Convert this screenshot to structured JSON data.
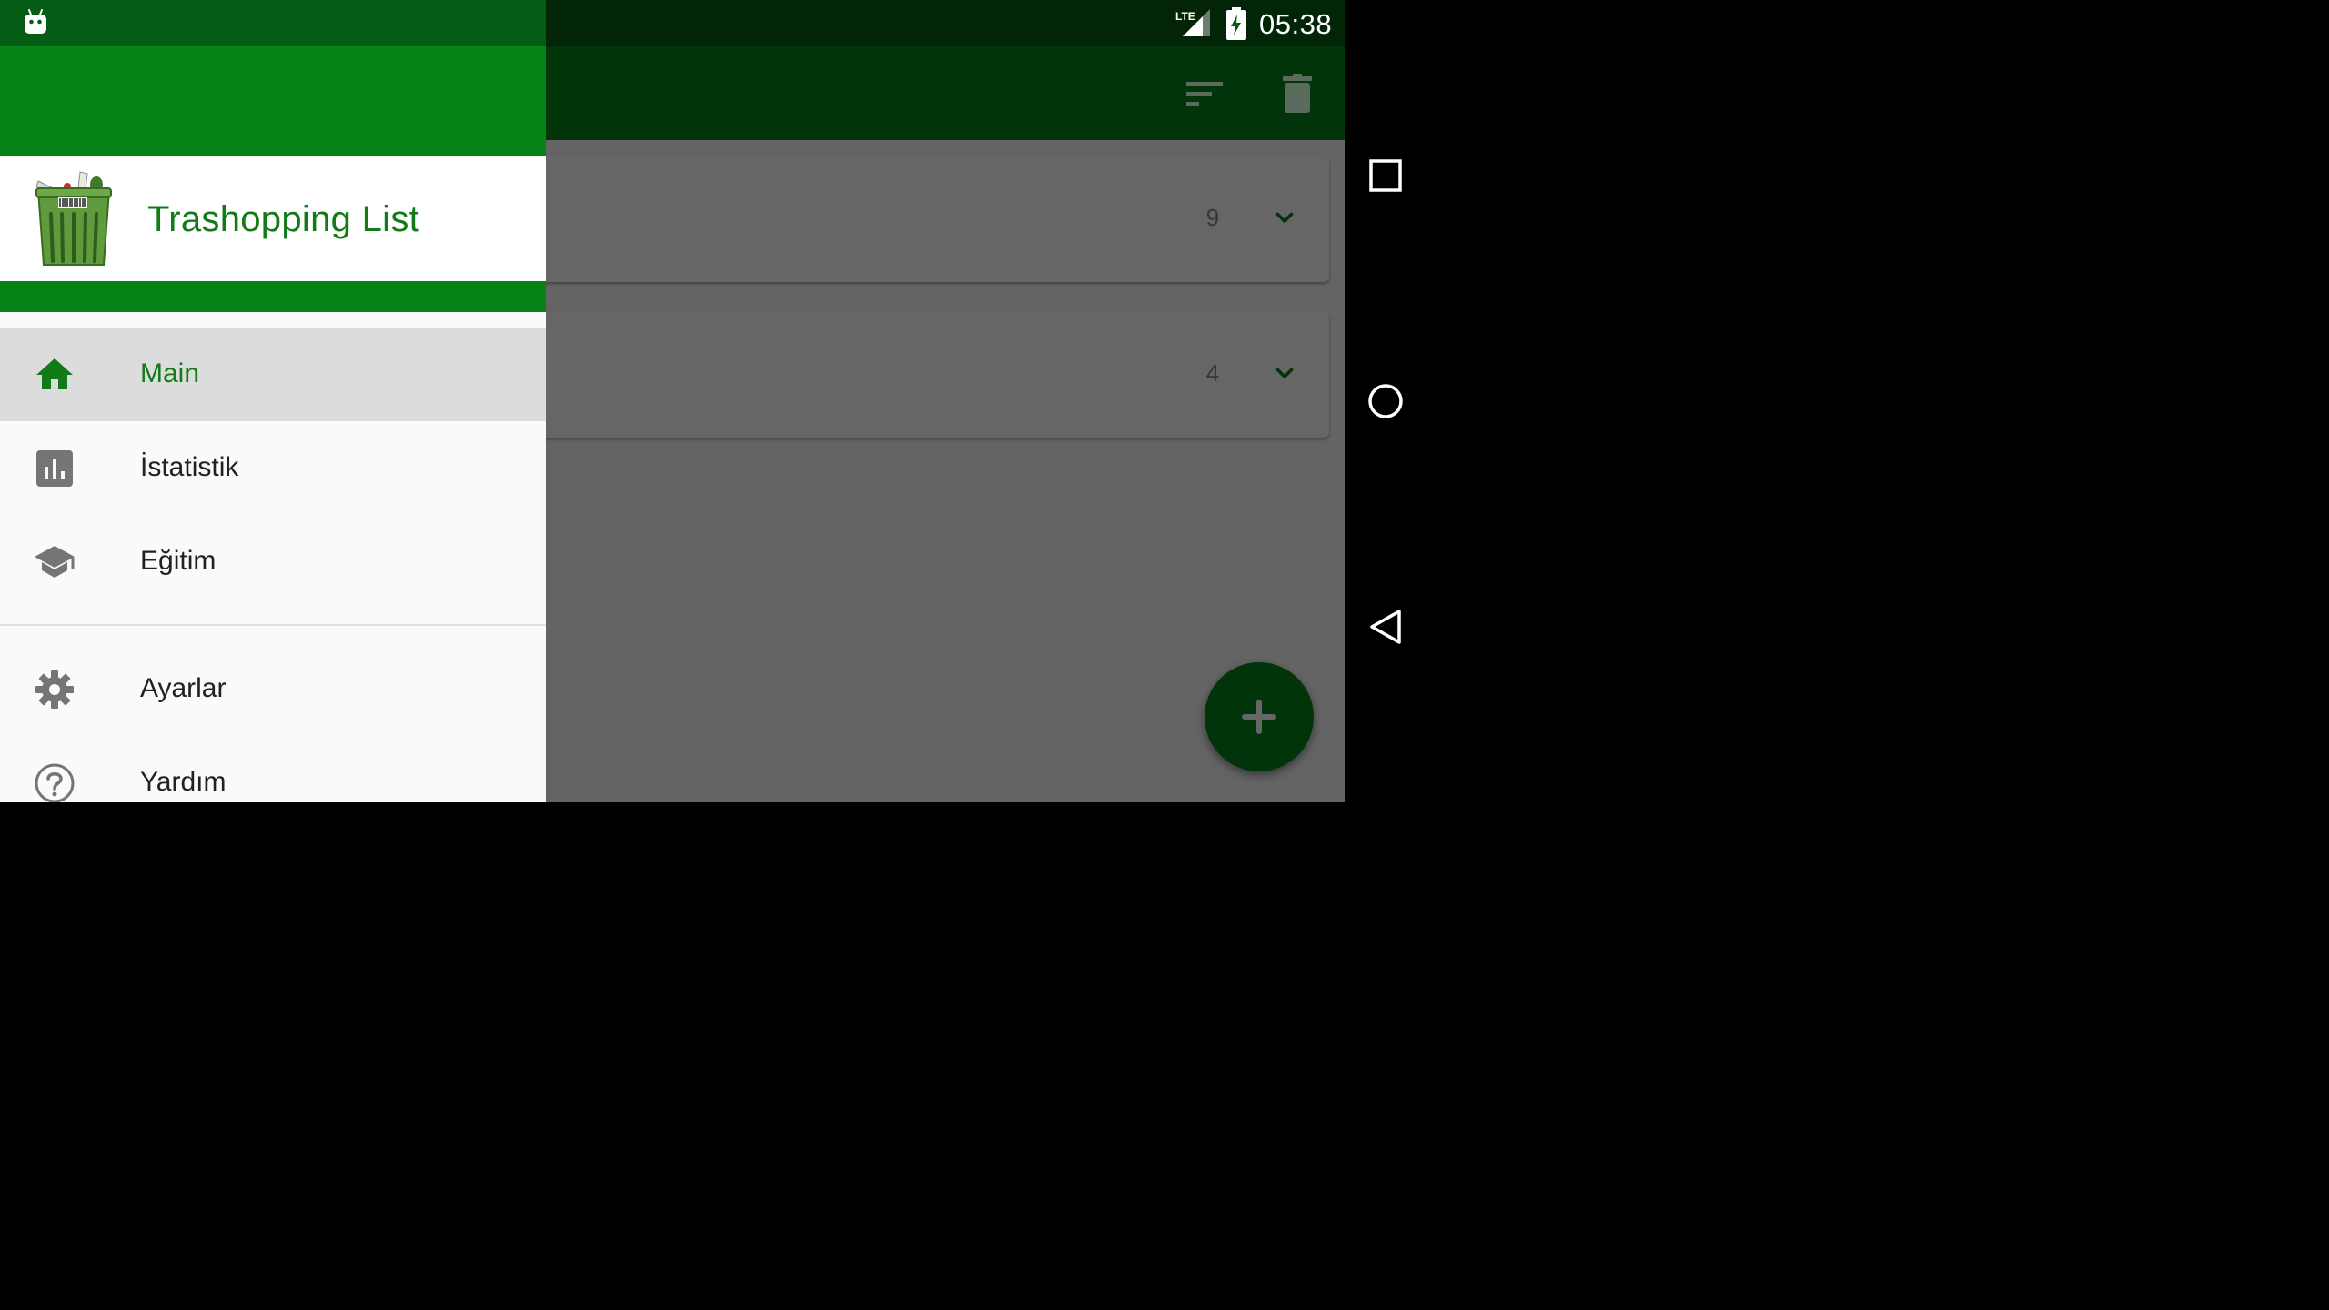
{
  "status_bar": {
    "time": "05:38",
    "network_label": "LTE",
    "icons": [
      "android-notification-icon",
      "signal-icon",
      "battery-charging-icon"
    ]
  },
  "toolbar": {
    "actions": [
      "sort-icon",
      "delete-icon"
    ]
  },
  "lists": [
    {
      "count": "9",
      "action": "chevron-down-icon"
    },
    {
      "count": "4",
      "action": "chevron-down-icon"
    }
  ],
  "fab": {
    "icon": "plus-icon"
  },
  "drawer": {
    "app_title": "Trashopping List",
    "items": [
      {
        "label": "Main",
        "icon": "home-icon",
        "active": true
      },
      {
        "label": "İstatistik",
        "icon": "bar-chart-icon",
        "active": false
      },
      {
        "label": "Eğitim",
        "icon": "school-icon",
        "active": false
      },
      {
        "label": "Ayarlar",
        "icon": "gear-icon",
        "active": false
      },
      {
        "label": "Yardım",
        "icon": "help-icon",
        "active": false
      }
    ]
  },
  "navigation_bar": {
    "buttons": [
      "recents-icon",
      "home-circle-icon",
      "back-icon"
    ]
  },
  "colors": {
    "primary": "#078217",
    "primary_dark": "#055c15",
    "accent_text": "#137a18",
    "drawer_active_bg": "#dcdcdc"
  }
}
